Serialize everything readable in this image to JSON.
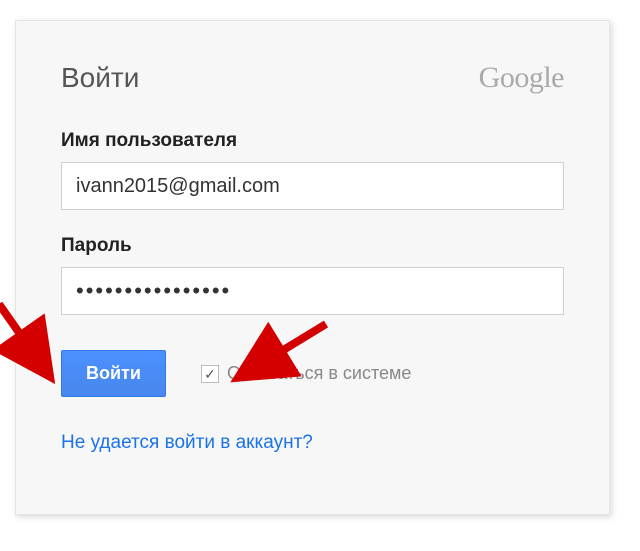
{
  "header": {
    "title": "Войти",
    "brand": "Google"
  },
  "fields": {
    "username_label": "Имя пользователя",
    "username_value": "ivann2015@gmail.com",
    "password_label": "Пароль",
    "password_value": "••••••••••••••••"
  },
  "actions": {
    "signin_label": "Войти",
    "stay_signed_label": "Оставаться в системе",
    "stay_signed_checked": true
  },
  "help": {
    "link_text": "Не удается войти в аккаунт?"
  }
}
